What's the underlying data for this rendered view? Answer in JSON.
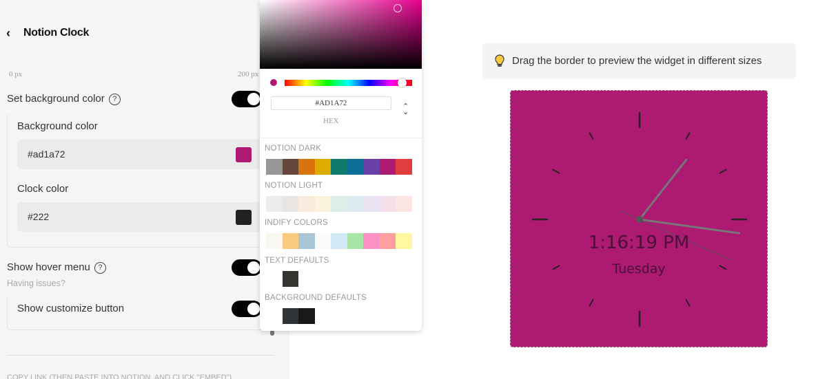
{
  "header": {
    "back_icon": "chevron-left-icon",
    "title": "Notion Clock"
  },
  "range": {
    "min_label": "0 px",
    "max_label": "200 px"
  },
  "set_background": {
    "label": "Set background color",
    "help_icon": "question-circle-icon",
    "enabled": true
  },
  "background_color": {
    "label": "Background color",
    "value": "#ad1a72",
    "swatch": "#ad1a72"
  },
  "clock_color": {
    "label": "Clock color",
    "value": "#222",
    "swatch": "#222222"
  },
  "hover_menu": {
    "label": "Show hover menu",
    "help_icon": "question-circle-icon",
    "enabled": true,
    "issues_link": "Having issues?"
  },
  "customize_button": {
    "label": "Show customize button",
    "enabled": true
  },
  "copy_link_label": "COPY LINK (THEN PASTE INTO NOTION, AND CLICK \"EMBED\")",
  "picker": {
    "hex_value": "#AD1A72",
    "mode_label": "HEX",
    "hue_fraction": 0.92,
    "sections": [
      {
        "title": "NOTION DARK",
        "colors": [
          "#979797",
          "#64473a",
          "#d9730d",
          "#dfab01",
          "#0f7b6c",
          "#0b6e99",
          "#6940a5",
          "#ad1a72",
          "#e03e3e"
        ]
      },
      {
        "title": "NOTION LIGHT",
        "colors": [
          "#ebeced",
          "#e9e5e3",
          "#faebdd",
          "#fbf3db",
          "#ddedea",
          "#ddebf1",
          "#eae4f2",
          "#f4dfeb",
          "#fbe4e4"
        ]
      },
      {
        "title": "INDIFY COLORS",
        "colors": [
          "#f8f8f0",
          "#f9c97f",
          "#a9c6d6",
          "#fafafa",
          "#d2e8f4",
          "#a8e6a8",
          "#fa90c4",
          "#ff9e9e",
          "#fff8a0"
        ]
      },
      {
        "title": "TEXT DEFAULTS",
        "colors": [
          "#ffffff",
          "#37352f"
        ]
      },
      {
        "title": "BACKGROUND DEFAULTS",
        "colors": [
          "#ffffff",
          "#2f3437",
          "#191919"
        ]
      }
    ]
  },
  "preview": {
    "hint_icon": "lightbulb-icon",
    "hint": "Drag the border to preview the widget in different sizes",
    "time": "1:16:19 PM",
    "day": "Tuesday",
    "background": "#ad1a72",
    "clock_color": "#222222",
    "hours": 1,
    "minutes": 16,
    "seconds": 19
  }
}
